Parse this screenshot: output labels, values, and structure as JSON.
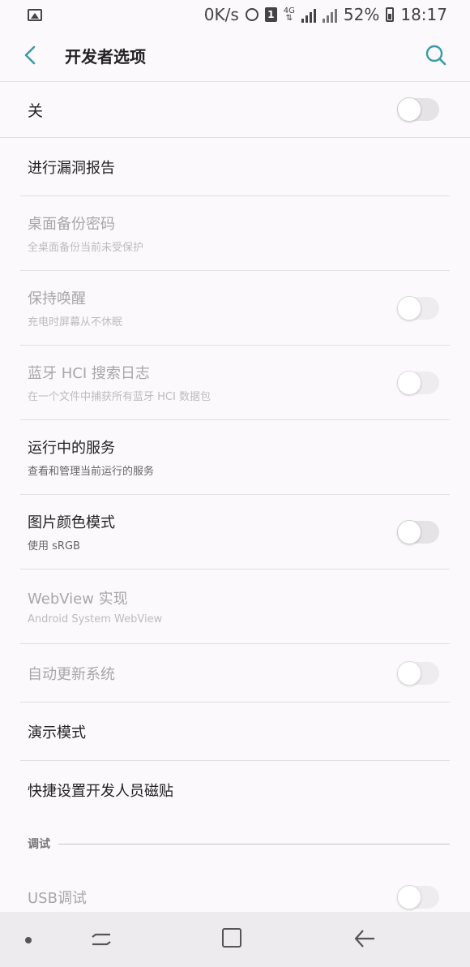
{
  "status_bar": {
    "speed": "0K/s",
    "sim_number": "1",
    "network": "4G",
    "battery": "52%",
    "time": "18:17"
  },
  "header": {
    "title": "开发者选项"
  },
  "master_switch": {
    "label": "关",
    "on": false
  },
  "settings": [
    {
      "title": "进行漏洞报告",
      "subtitle": "",
      "enabled": true,
      "toggle": null
    },
    {
      "title": "桌面备份密码",
      "subtitle": "全桌面备份当前未受保护",
      "enabled": false,
      "toggle": null
    },
    {
      "title": "保持唤醒",
      "subtitle": "充电时屏幕从不休眠",
      "enabled": false,
      "toggle": false
    },
    {
      "title": "蓝牙 HCI 搜索日志",
      "subtitle": "在一个文件中捕获所有蓝牙 HCI 数据包",
      "enabled": false,
      "toggle": false
    },
    {
      "title": "运行中的服务",
      "subtitle": "查看和管理当前运行的服务",
      "enabled": true,
      "toggle": null
    },
    {
      "title": "图片颜色模式",
      "subtitle": "使用 sRGB",
      "enabled": true,
      "toggle": false
    },
    {
      "title": "WebView 实现",
      "subtitle": "Android System WebView",
      "enabled": false,
      "toggle": null
    },
    {
      "title": "自动更新系统",
      "subtitle": "",
      "enabled": false,
      "toggle": false
    },
    {
      "title": "演示模式",
      "subtitle": "",
      "enabled": true,
      "toggle": null
    },
    {
      "title": "快捷设置开发人员磁贴",
      "subtitle": "",
      "enabled": true,
      "toggle": null
    }
  ],
  "debug_section": {
    "header": "调试",
    "items": [
      {
        "title": "USB调试",
        "enabled": false,
        "toggle": false
      }
    ]
  },
  "colors": {
    "accent": "#3a9aa7",
    "background": "#fcf9fc",
    "disabled_text": "#a8a6a8"
  }
}
